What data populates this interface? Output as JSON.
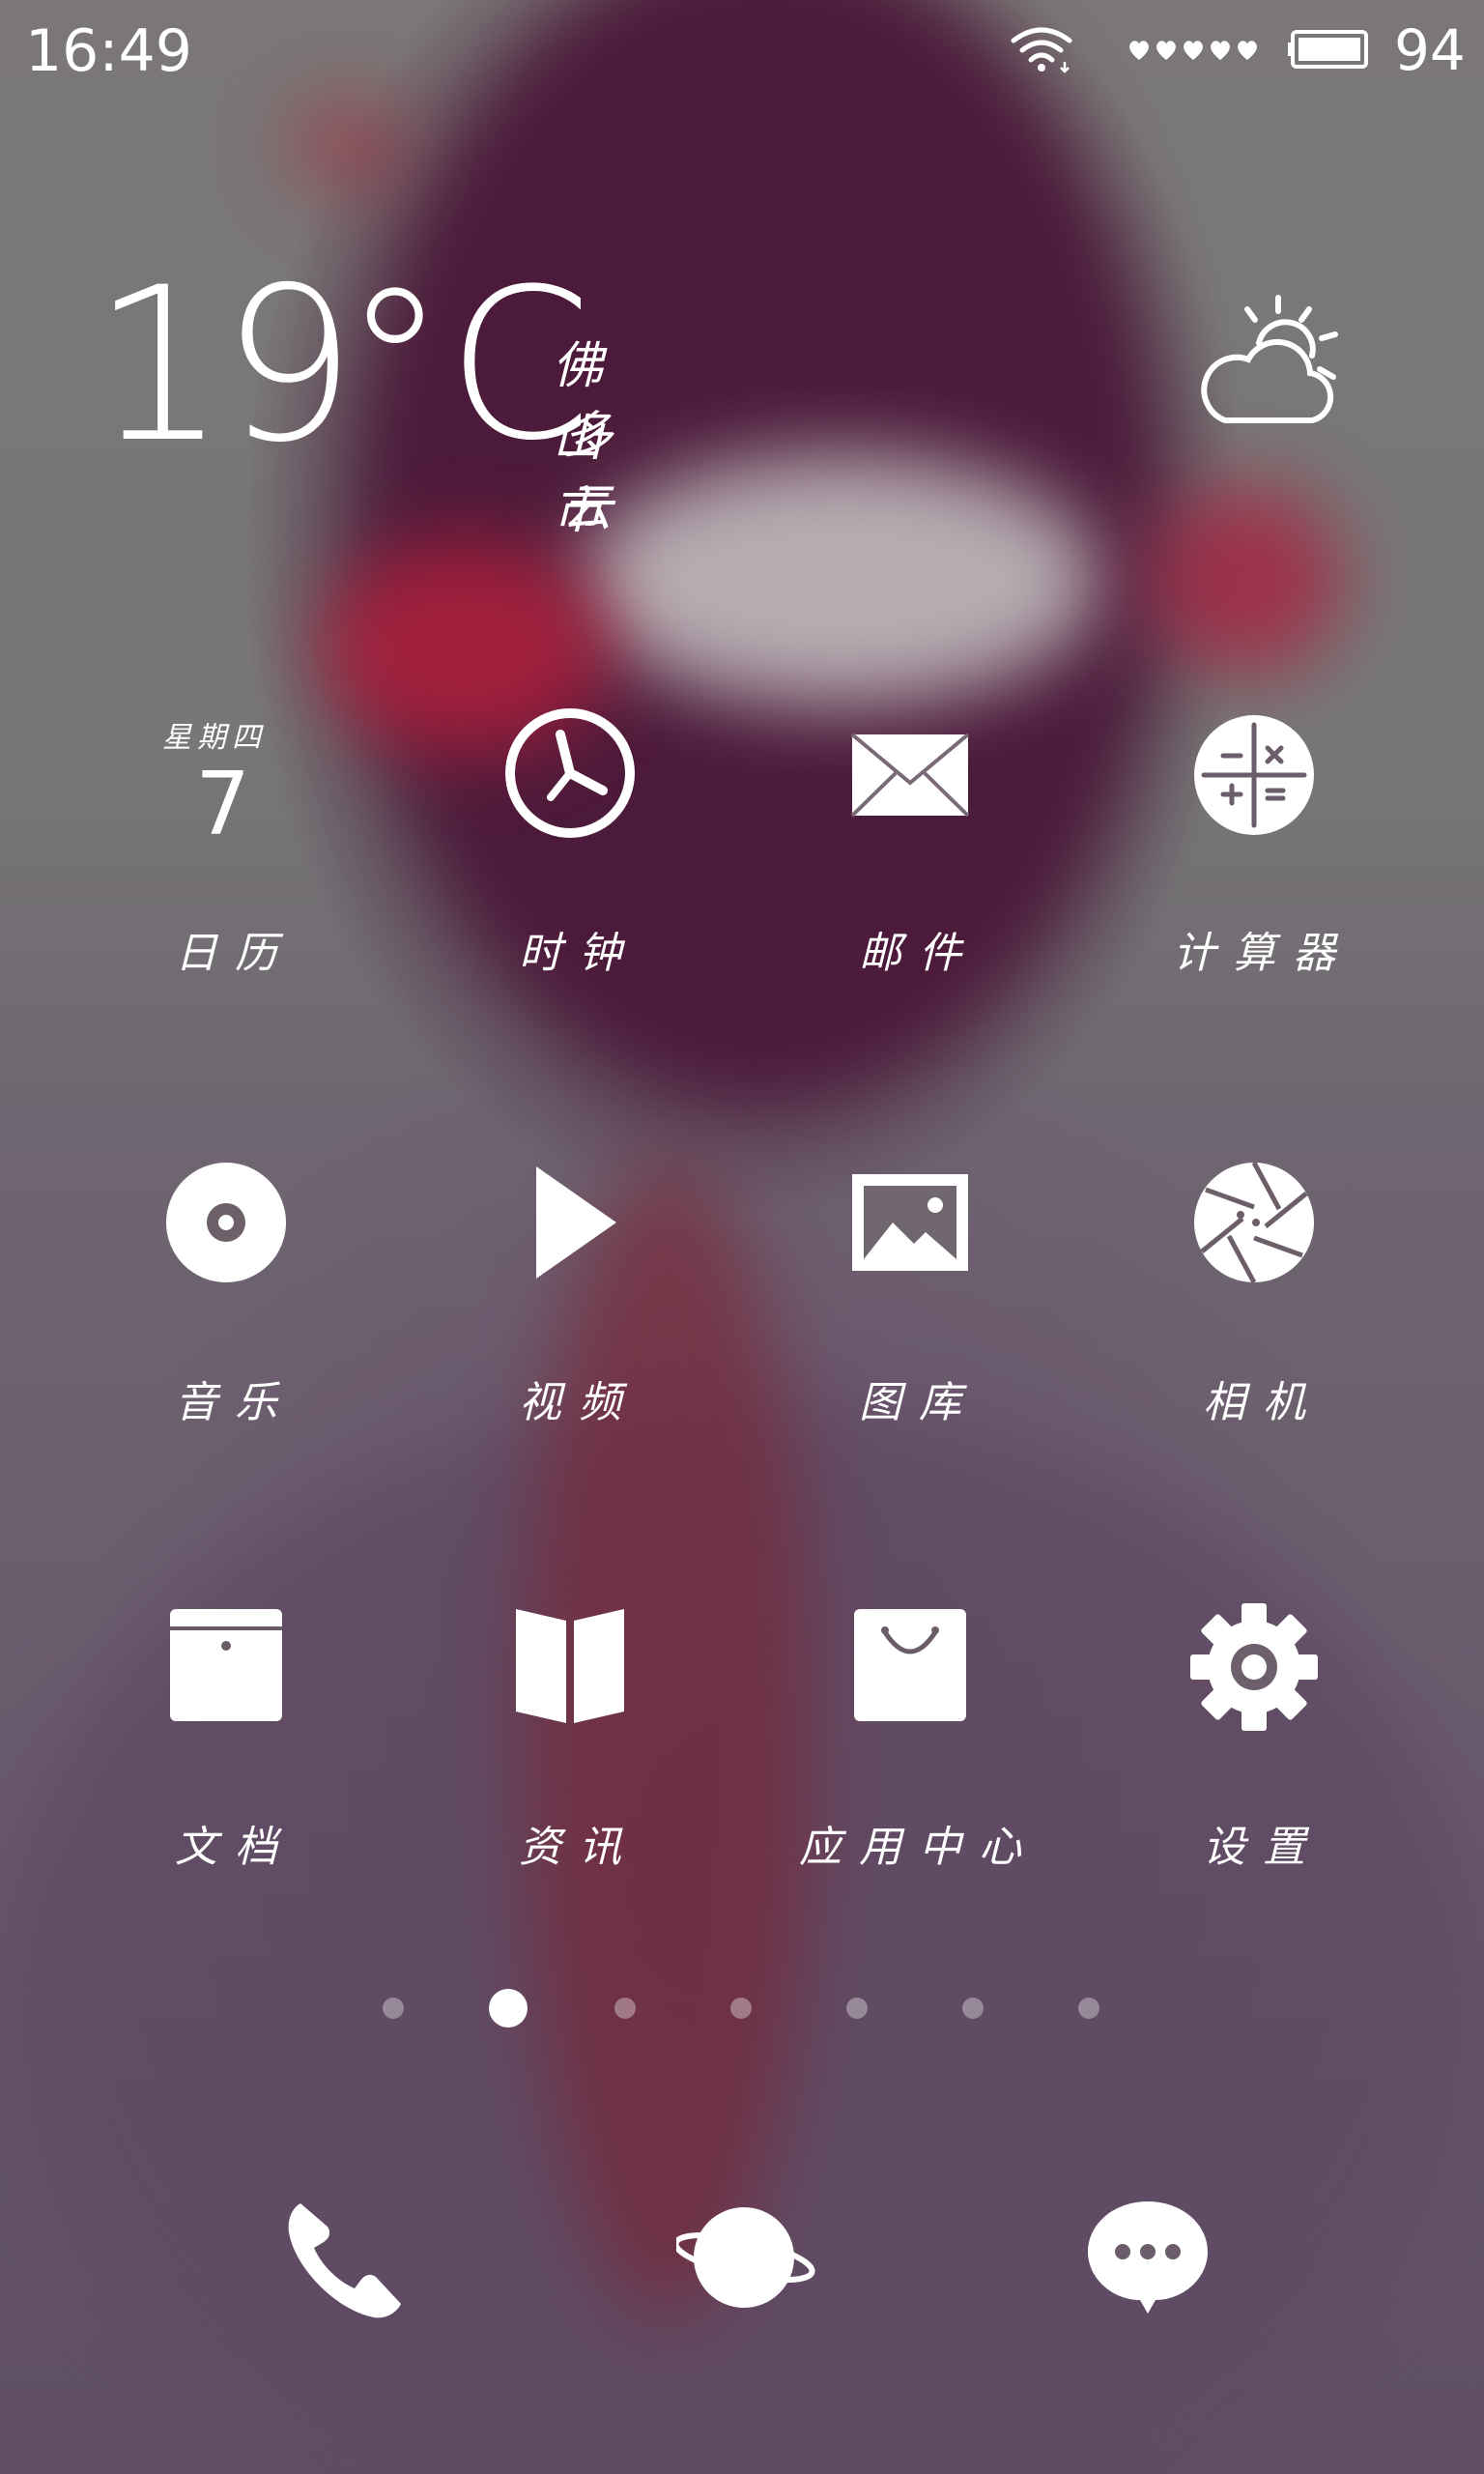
{
  "status_bar": {
    "time": "16:49",
    "battery_percent": "94",
    "icons": [
      "wifi-icon",
      "signal-icon",
      "battery-icon"
    ]
  },
  "weather": {
    "temperature": "19",
    "unit": "°C",
    "city": "佛山市",
    "condition": "多云",
    "icon": "partly-cloudy-icon"
  },
  "calendar_widget": {
    "weekday": "星期四",
    "day": "7"
  },
  "apps": [
    {
      "label": "日历",
      "icon": "calendar-icon"
    },
    {
      "label": "时钟",
      "icon": "clock-icon"
    },
    {
      "label": "邮件",
      "icon": "mail-icon"
    },
    {
      "label": "计算器",
      "icon": "calculator-icon"
    },
    {
      "label": "音乐",
      "icon": "music-disc-icon"
    },
    {
      "label": "视频",
      "icon": "play-icon"
    },
    {
      "label": "图库",
      "icon": "gallery-icon"
    },
    {
      "label": "相机",
      "icon": "camera-aperture-icon"
    },
    {
      "label": "文档",
      "icon": "document-box-icon"
    },
    {
      "label": "资讯",
      "icon": "book-icon"
    },
    {
      "label": "应用中心",
      "icon": "shopping-bag-icon"
    },
    {
      "label": "设置",
      "icon": "gear-icon"
    }
  ],
  "page_indicator": {
    "count": 7,
    "active_index": 1
  },
  "dock": [
    {
      "icon": "phone-icon"
    },
    {
      "icon": "browser-planet-icon"
    },
    {
      "icon": "message-bubble-icon"
    }
  ],
  "colors": {
    "foreground": "#ffffff",
    "wallpaper_dark": "#4a1b3a",
    "wallpaper_gray": "#777777"
  }
}
